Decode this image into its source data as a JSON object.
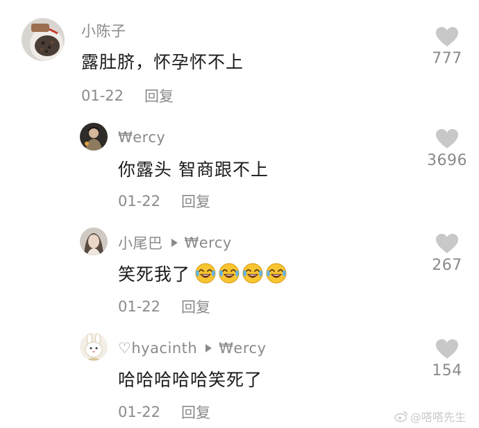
{
  "comments": [
    {
      "username": "小陈子",
      "reply_to": "",
      "text": "露肚脐，怀孕怀不上",
      "date": "01-22",
      "reply_label": "回复",
      "likes": "777",
      "avatar": "food-photo-avatar",
      "emoji_count": 0
    },
    {
      "username": "₩ercy",
      "reply_to": "",
      "text": "你露头 智商跟不上",
      "date": "01-22",
      "reply_label": "回复",
      "likes": "3696",
      "avatar": "dark-photo-avatar",
      "emoji_count": 0
    },
    {
      "username": "小尾巴",
      "reply_to": "₩ercy",
      "text": "笑死我了",
      "date": "01-22",
      "reply_label": "回复",
      "likes": "267",
      "avatar": "person-photo-avatar",
      "emoji_count": 4,
      "emoji": "laughing-crying-emoji"
    },
    {
      "username": "♡hyacinth",
      "reply_to": "₩ercy",
      "text": "哈哈哈哈哈笑死了",
      "date": "01-22",
      "reply_label": "回复",
      "likes": "154",
      "avatar": "bunny-cartoon-avatar",
      "emoji_count": 0
    }
  ],
  "watermark": "@嗒嗒先生",
  "colors": {
    "background": "#ffffff",
    "text_primary": "#1a1a1a",
    "text_secondary": "#8a8a8a",
    "heart_icon": "#c8c8c8",
    "emoji_face": "#f7c531"
  }
}
